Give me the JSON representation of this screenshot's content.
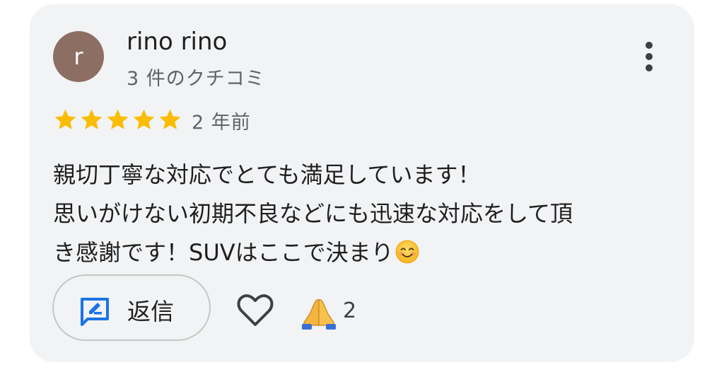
{
  "review": {
    "avatar_initial": "r",
    "author_name": "rino rino",
    "review_count": "3 件のクチコミ",
    "rating": 5,
    "time_ago": "2 年前",
    "text_lines": [
      "親切丁寧な対応でとても満足しています！",
      "思いがけない初期不良などにも迅速な対応をして頂",
      "き感謝です！SUVはここで決まり"
    ],
    "text_trailing_emoji": "smiling-face-emoji",
    "reply_label": "返信",
    "reaction_count": "2"
  },
  "icons": {
    "more": "more-vertical-icon",
    "star": "star-icon",
    "reply": "reply-edit-icon",
    "like": "heart-icon",
    "reaction": "folded-hands-icon"
  },
  "colors": {
    "card_background": "#f2f3f5",
    "avatar_background": "#8d6e63",
    "star": "#fbbc04",
    "reply_icon": "#1a73e8",
    "primary_text": "#1f1f1f",
    "secondary_text": "#5f6368"
  }
}
